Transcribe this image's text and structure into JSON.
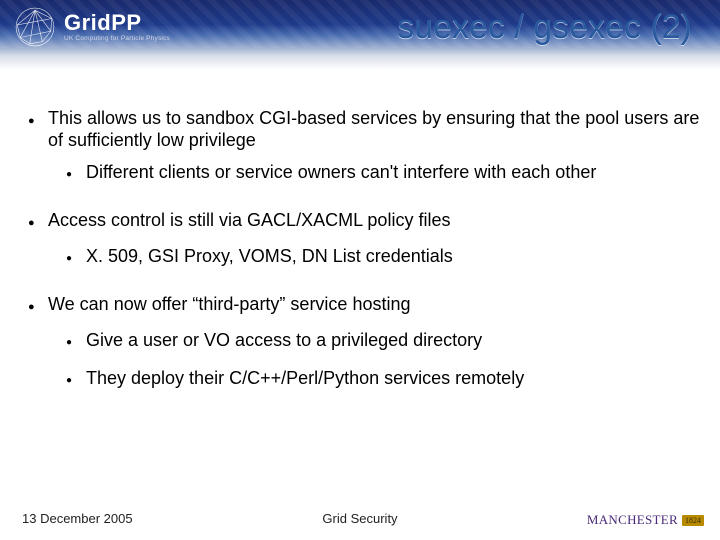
{
  "logo": {
    "brand": "GridPP",
    "tagline": "UK Computing for Particle Physics"
  },
  "title": "suexec / gsexec (2)",
  "bullets": {
    "b1": "This allows us to sandbox CGI-based services by ensuring that the pool users are of sufficiently low privilege",
    "b1a": "Different clients or service owners can't interfere with each other",
    "b2": "Access control is still via GACL/XACML policy files",
    "b2a": "X. 509, GSI Proxy, VOMS, DN List credentials",
    "b3": "We can now offer “third-party” service hosting",
    "b3a": "Give a user or VO access to a privileged directory",
    "b3b": "They deploy their C/C++/Perl/Python services remotely"
  },
  "footer": {
    "date": "13 December 2005",
    "center": "Grid Security",
    "university": "MANCHESTER",
    "year": "1824"
  },
  "colors": {
    "title_color": "#2a5a9e",
    "header_dark": "#1a2a6c"
  }
}
